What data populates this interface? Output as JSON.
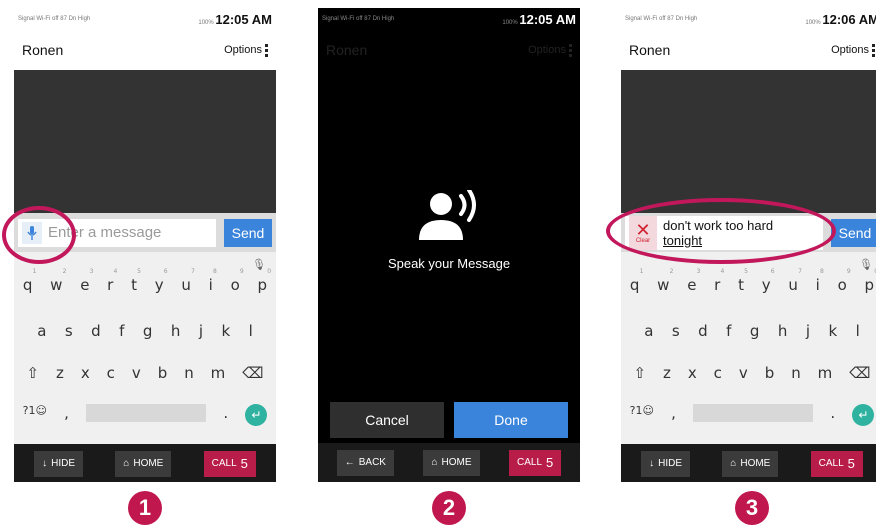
{
  "status": {
    "left": "Signal  Wi-Fi off  87 Dn  High",
    "battery": "100%",
    "time1": "12:05 AM",
    "time2": "12:05 AM",
    "time3": "12:06 AM"
  },
  "header": {
    "contact": "Ronen",
    "options": "Options"
  },
  "compose": {
    "placeholder": "Enter a message",
    "send": "Send",
    "clear": "Clear",
    "message_line1": "don't work too hard",
    "message_line2": "tonight"
  },
  "keyboard": {
    "row1": [
      "q",
      "w",
      "e",
      "r",
      "t",
      "y",
      "u",
      "i",
      "o",
      "p"
    ],
    "row1_hints": [
      "1",
      "2",
      "3",
      "4",
      "5",
      "6",
      "7",
      "8",
      "9",
      "0"
    ],
    "row2": [
      "a",
      "s",
      "d",
      "f",
      "g",
      "h",
      "j",
      "k",
      "l"
    ],
    "row3": [
      "z",
      "x",
      "c",
      "v",
      "b",
      "n",
      "m"
    ],
    "sym": "?1☺",
    "comma": ",",
    "period": "."
  },
  "nav": {
    "hide": "HIDE",
    "back": "BACK",
    "home": "HOME",
    "call": "CALL",
    "call_num": "5"
  },
  "speech": {
    "prompt": "Speak your Message",
    "cancel": "Cancel",
    "done": "Done"
  },
  "steps": [
    "1",
    "2",
    "3"
  ],
  "colors": {
    "accent": "#3a84db",
    "highlight": "#c2185b",
    "call": "#b81d4a"
  }
}
